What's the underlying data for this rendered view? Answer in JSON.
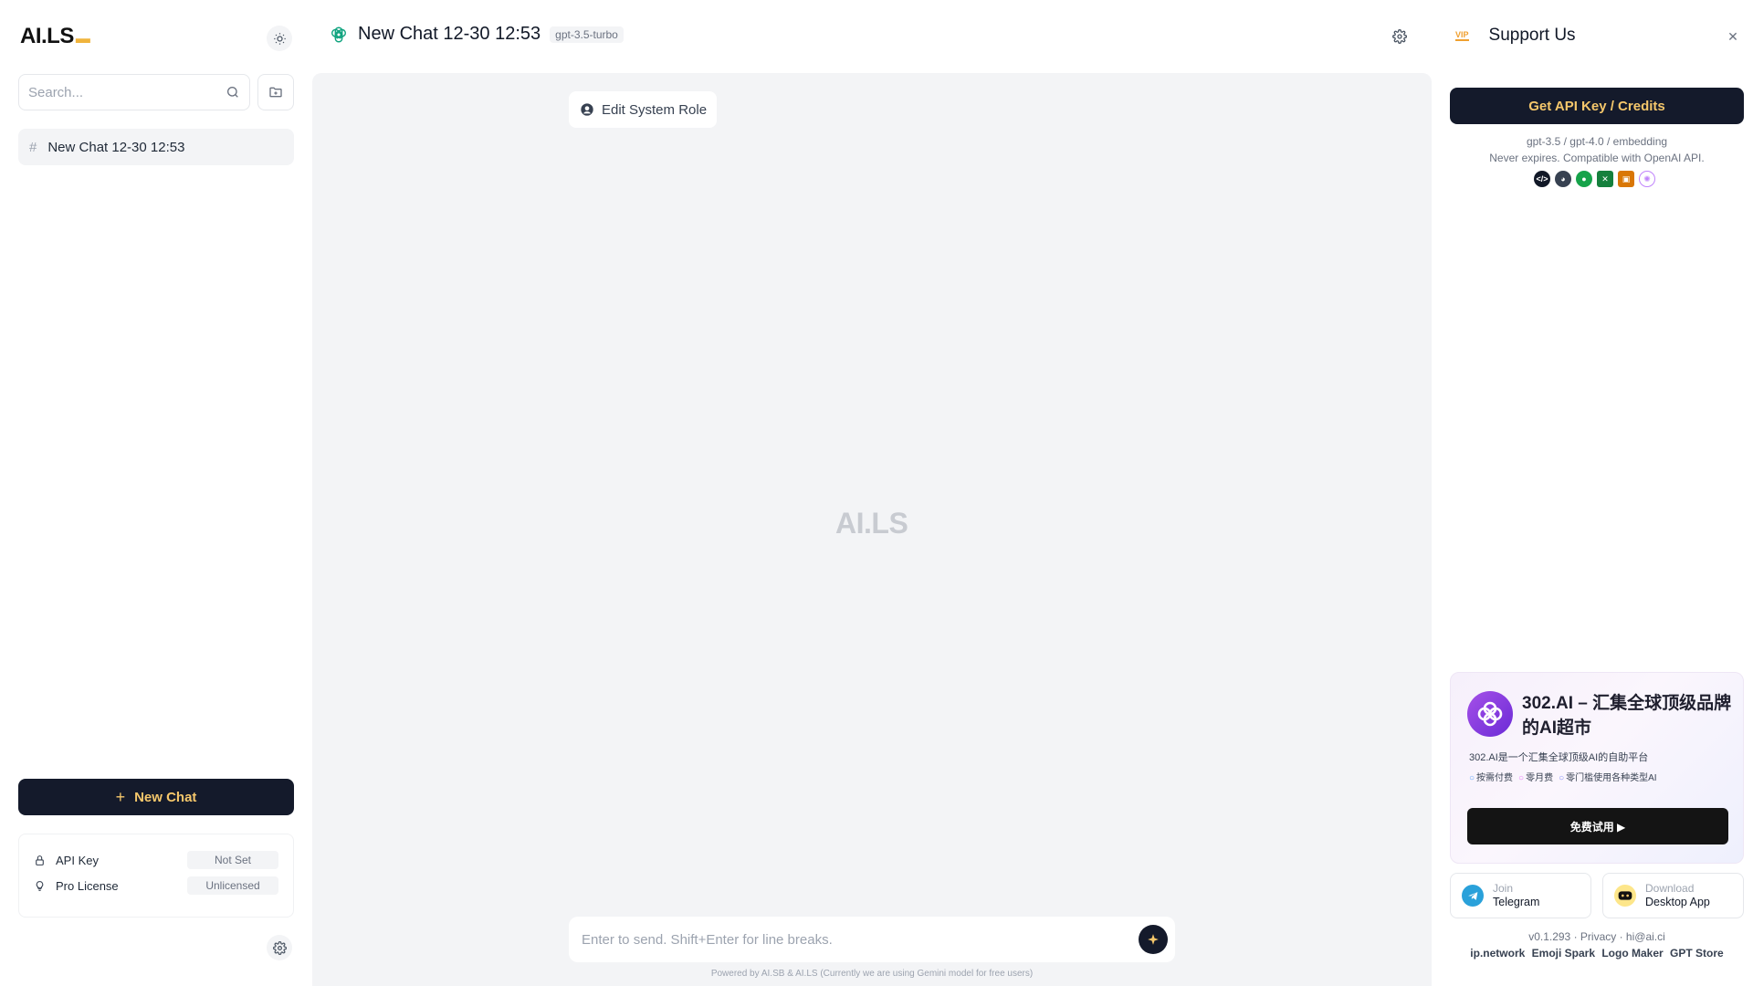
{
  "sidebar": {
    "logo_text": "AI.LS",
    "search_placeholder": "Search...",
    "chats": [
      {
        "title": "New Chat 12-30 12:53"
      }
    ],
    "new_chat_label": "New Chat",
    "status": {
      "api_key_label": "API Key",
      "api_key_value": "Not Set",
      "license_label": "Pro License",
      "license_value": "Unlicensed"
    }
  },
  "header": {
    "title": "New Chat 12-30 12:53",
    "model": "gpt-3.5-turbo"
  },
  "main": {
    "system_role_label": "Edit System Role",
    "watermark": "AI.LS",
    "input_placeholder": "Enter to send. Shift+Enter for line breaks.",
    "powered_by": "Powered by AI.SB & AI.LS (Currently we are using Gemini model for free users)"
  },
  "right_panel": {
    "vip_label": "VIP",
    "title": "Support Us",
    "api_button_label": "Get API Key / Credits",
    "api_desc_line1": "gpt-3.5 / gpt-4.0 / embedding",
    "api_desc_line2": "Never expires. Compatible with OpenAI API.",
    "provider_icons": [
      "code-icon",
      "cat-icon",
      "chat-bubble-icon",
      "x-icon",
      "box-icon",
      "openai-icon"
    ],
    "promo": {
      "title": "302.AI – 汇集全球顶级品牌的AI超市",
      "subtitle": "302.AI是一个汇集全球顶级AI的自助平台",
      "features": [
        "按需付费",
        "零月费",
        "零门槛使用各种类型AI"
      ],
      "button_label": "免费试用 ▶"
    },
    "telegram": {
      "small": "Join",
      "big": "Telegram"
    },
    "desktop": {
      "small": "Download",
      "big": "Desktop App"
    },
    "footer": {
      "version": "v0.1.293",
      "privacy": "Privacy",
      "email": "hi@ai.ci",
      "links": [
        "ip.network",
        "Emoji Spark",
        "Logo Maker",
        "GPT Store"
      ]
    }
  },
  "colors": {
    "accent": "#f5c76b",
    "dark_button": "#141a2b",
    "main_bg": "#f3f4f6"
  }
}
